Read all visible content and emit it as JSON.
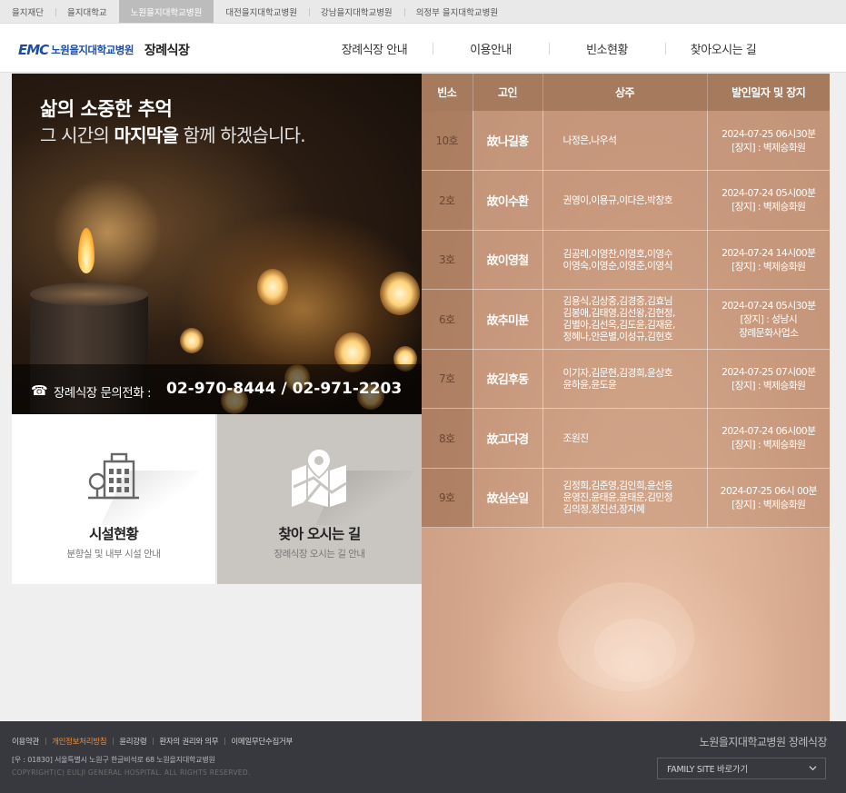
{
  "topbar": {
    "items": [
      {
        "label": "을지재단",
        "active": false
      },
      {
        "label": "을지대학교",
        "active": false
      },
      {
        "label": "노원을지대학교병원",
        "active": true
      },
      {
        "label": "대전을지대학교병원",
        "active": false
      },
      {
        "label": "강남을지대학교병원",
        "active": false
      },
      {
        "label": "의정부 을지대학교병원",
        "active": false
      }
    ]
  },
  "header": {
    "logo_mark": "EMC",
    "logo_hospital": "노원을지대학교병원",
    "logo_dept": "장례식장",
    "nav": [
      "장례식장 안내",
      "이용안내",
      "빈소현황",
      "찾아오시는 길"
    ]
  },
  "hero": {
    "line1": "삶의 소중한 추억",
    "line2_pre": "그 시간의 ",
    "line2_bold": "마지막을",
    "line2_post": " 함께 하겠습니다.",
    "phone_label": "장례식장 문의전화 :",
    "phone_number": "02-970-8444 / 02-971-2203"
  },
  "quick": [
    {
      "title": "시설현황",
      "subtitle": "분향실 및 내부 시설 안내",
      "icon": "building-icon"
    },
    {
      "title": "찾아 오시는 길",
      "subtitle": "장례식장 오시는 길 안내",
      "icon": "map-pin-icon"
    }
  ],
  "obituary": {
    "headers": [
      "빈소",
      "고인",
      "상주",
      "발인일자 및 장지"
    ],
    "rows": [
      {
        "room": "10호",
        "deceased": "故나길홍",
        "mourners": [
          "나정은,나우석"
        ],
        "date": "2024-07-25   06시30분",
        "place": [
          "[장지] : 벽제승화원"
        ]
      },
      {
        "room": "2호",
        "deceased": "故이수환",
        "mourners": [
          "권영이,이용규,이다은,박창호"
        ],
        "date": "2024-07-24   05시00분",
        "place": [
          "[장지] : 벽제승화원"
        ]
      },
      {
        "room": "3호",
        "deceased": "故이영철",
        "mourners": [
          "김공례,이영찬,이영호,이영수",
          "이영숙,이영순,이영준,이영식"
        ],
        "date": "2024-07-24   14시00분",
        "place": [
          "[장지] : 벽제승화원"
        ]
      },
      {
        "room": "6호",
        "deceased": "故추미분",
        "mourners": [
          "김용식,김상중,김경중,김효님",
          "김봉애,김태영,김선왕,김현정,",
          "김별아,김선옥,김도윤,김재윤,",
          "정혜나,안은별,이성규,김현호"
        ],
        "date": "2024-07-24   05시30분",
        "place": [
          "[장지] : 성남시",
          "장례문화사업소"
        ]
      },
      {
        "room": "7호",
        "deceased": "故김후동",
        "mourners": [
          "이기자,김문현,김경희,윤상호",
          "윤하윤,윤도윤"
        ],
        "date": "2024-07-25   07시00분",
        "place": [
          "[장지] : 벽제승화원"
        ]
      },
      {
        "room": "8호",
        "deceased": "故고다경",
        "mourners": [
          "조원진"
        ],
        "date": "2024-07-24   06시00분",
        "place": [
          "[장지] : 벽제승화원"
        ]
      },
      {
        "room": "9호",
        "deceased": "故심순일",
        "mourners": [
          "김정희,김준영,김인희,윤선용",
          "윤영진,윤태윤,윤태운,김민정",
          "김의정,정진선,장지혜"
        ],
        "date": "2024-07-25   06시 00분",
        "place": [
          "[장지] : 벽제승화원"
        ]
      }
    ]
  },
  "footer": {
    "links": [
      {
        "label": "이용약관",
        "highlight": false
      },
      {
        "label": "개인정보처리방침",
        "highlight": true
      },
      {
        "label": "윤리강령",
        "highlight": false
      },
      {
        "label": "환자의 권리와 의무",
        "highlight": false
      },
      {
        "label": "이메일무단수집거부",
        "highlight": false
      }
    ],
    "address": "[우 : 01830] 서울특별시 노원구 한글비석로 68 노원을지대학교병원",
    "copyright": "COPYRIGHT(C) EULJI GENERAL HOSPITAL. ALL RIGHTS RESERVED.",
    "brand": "노원을지대학교병원 장례식장",
    "family_site": "FAMILY SITE 바로가기"
  },
  "colors": {
    "brand_blue": "#1c4da1",
    "table_header": "#a57a5d",
    "footer_bg": "#37393e",
    "footer_highlight": "#f08a30"
  }
}
